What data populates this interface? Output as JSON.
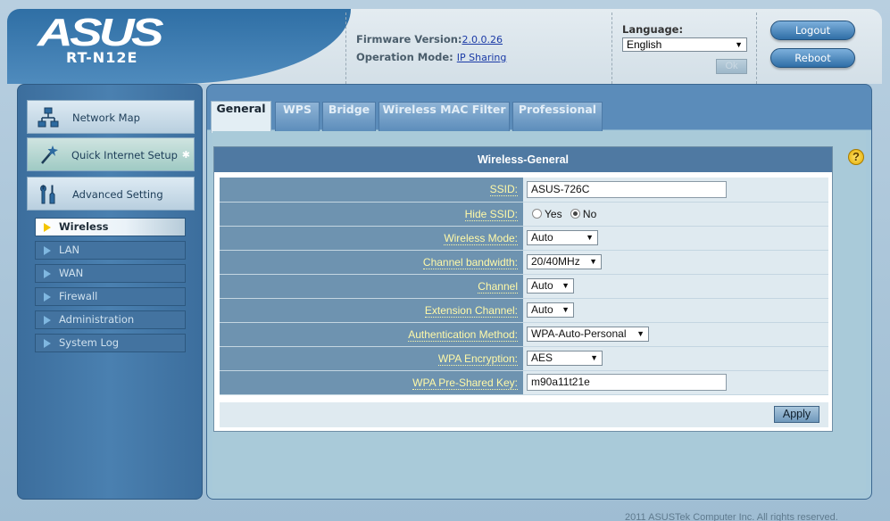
{
  "header": {
    "logo_text": "ASUS",
    "model": "RT-N12E",
    "firmware_label": "Firmware Version:",
    "firmware_value": "2.0.0.26",
    "mode_label": "Operation Mode:",
    "mode_value": "IP Sharing",
    "language_label": "Language:",
    "language_selected": "English",
    "ok_label": "Ok",
    "logout_label": "Logout",
    "reboot_label": "Reboot"
  },
  "sidebar": {
    "main_items": [
      {
        "label": "Network Map",
        "icon": "network-map-icon"
      },
      {
        "label": "Quick Internet Setup",
        "icon": "magic-wand-icon"
      },
      {
        "label": "Advanced Setting",
        "icon": "tools-icon"
      }
    ],
    "sub_items": [
      {
        "label": "Wireless",
        "active": true
      },
      {
        "label": "LAN",
        "active": false
      },
      {
        "label": "WAN",
        "active": false
      },
      {
        "label": "Firewall",
        "active": false
      },
      {
        "label": "Administration",
        "active": false
      },
      {
        "label": "System Log",
        "active": false
      }
    ]
  },
  "tabs": [
    "General",
    "WPS",
    "Bridge",
    "Wireless MAC Filter",
    "Professional"
  ],
  "active_tab": "General",
  "panel": {
    "title": "Wireless-General",
    "fields": [
      {
        "label": "SSID:",
        "type": "text",
        "value": "ASUS-726C"
      },
      {
        "label": "Hide SSID:",
        "type": "radio",
        "options": [
          "Yes",
          "No"
        ],
        "selected": "No"
      },
      {
        "label": "Wireless Mode:",
        "type": "select",
        "value": "Auto"
      },
      {
        "label": "Channel bandwidth:",
        "type": "select",
        "value": "20/40MHz"
      },
      {
        "label": "Channel",
        "type": "select",
        "value": "Auto"
      },
      {
        "label": "Extension Channel:",
        "type": "select",
        "value": "Auto"
      },
      {
        "label": "Authentication Method:",
        "type": "select",
        "value": "WPA-Auto-Personal"
      },
      {
        "label": "WPA Encryption:",
        "type": "select",
        "value": "AES"
      },
      {
        "label": "WPA Pre-Shared Key:",
        "type": "text",
        "value": "m90a11t21e"
      }
    ],
    "apply_label": "Apply"
  },
  "footer_text": "2011 ASUSTek Computer Inc. All rights reserved.",
  "colors": {
    "accent": "#4f79a2",
    "label_text": "#fff9a8",
    "active_arrow": "#f4c500"
  }
}
